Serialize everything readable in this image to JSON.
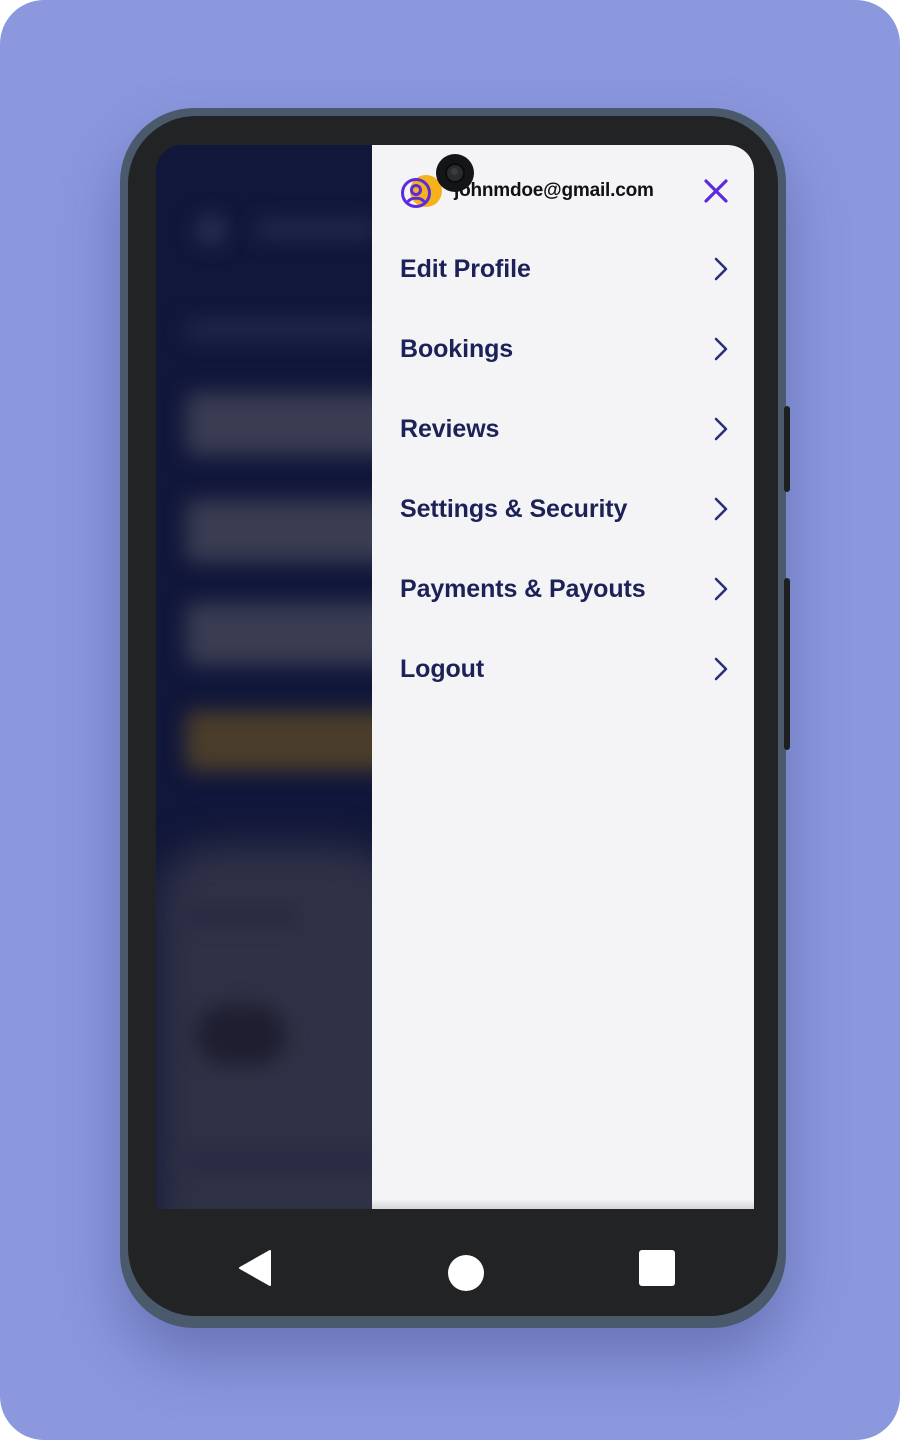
{
  "background_color": "#8B98DE",
  "drawer": {
    "email": "johnmdoe@gmail.com",
    "avatar_icon": "user-circle-icon",
    "close_icon": "close-icon",
    "accent_color": "#5B2BE0",
    "menu_items": [
      {
        "label": "Edit Profile"
      },
      {
        "label": "Bookings"
      },
      {
        "label": "Reviews"
      },
      {
        "label": "Settings & Security"
      },
      {
        "label": "Payments & Payouts"
      },
      {
        "label": "Logout"
      }
    ]
  },
  "system_nav": {
    "back_icon": "triangle-back-icon",
    "home_icon": "circle-home-icon",
    "recents_icon": "square-recents-icon"
  }
}
